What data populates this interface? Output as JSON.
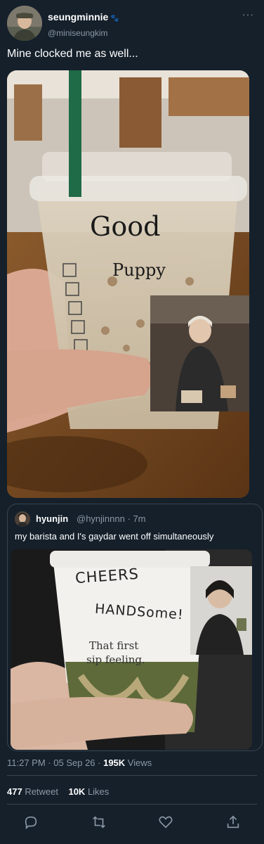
{
  "author": {
    "display_name": "seungminnie",
    "badge_icon": "paw-icon",
    "handle": "@miniseungkim"
  },
  "more_label": "···",
  "tweet_text": "Mine clocked me as well...",
  "cup_writing": {
    "line1": "Good",
    "line2": "Puppy"
  },
  "quote": {
    "display_name": "hyunjin",
    "handle": "@hynjinnnn",
    "time": "· 7m",
    "text": "my barista and I's gaydar went off simultaneously",
    "cup_writing": {
      "line1": "CHEERS",
      "line2": "HANDSome!",
      "printed1": "That first",
      "printed2": "sip feeling."
    }
  },
  "meta": {
    "time": "11:27 PM",
    "sep1": " · ",
    "date": "05 Sep 26",
    "sep2": " · ",
    "views_count": "195K",
    "views_label": " Views"
  },
  "stats": {
    "retweets_count": "477",
    "retweets_label": " Retweet",
    "likes_count": "10K",
    "likes_label": " Likes"
  },
  "actions": [
    "reply-icon",
    "retweet-icon",
    "like-icon",
    "share-icon"
  ],
  "colors": {
    "background": "#15202b",
    "secondary_text": "#8b98a5",
    "divider": "#38444d"
  }
}
